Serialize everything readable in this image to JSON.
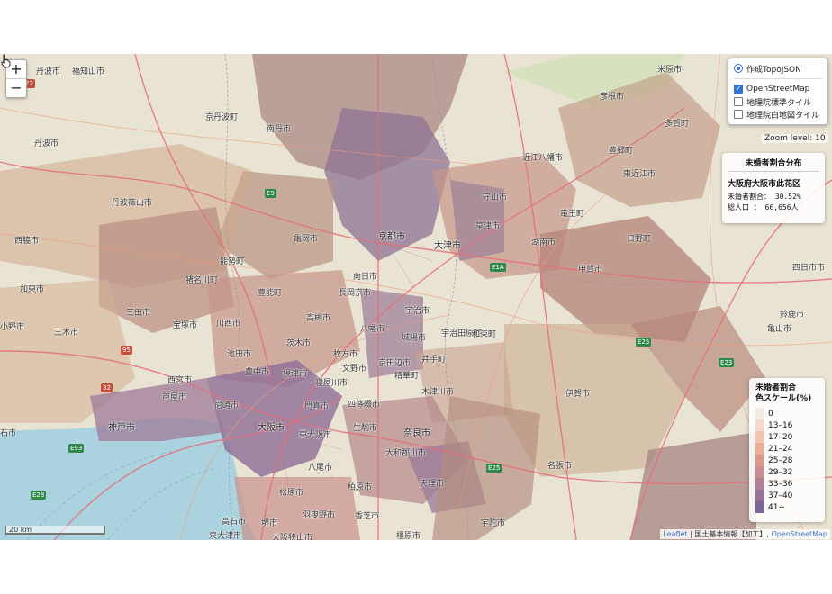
{
  "map": {
    "zoom_in": "+",
    "zoom_out": "−",
    "zoom_level_text": "Zoom level: 10",
    "scale_label": "20 km",
    "attribution": {
      "leaflet": "Leaflet",
      "sep1": " | 国土基本情報【加工】, ",
      "osm": "OpenStreetMap"
    }
  },
  "layers": {
    "overlay": {
      "label": "作成TopoJSON",
      "checked": true
    },
    "base": [
      {
        "label": "OpenStreetMap",
        "checked": true
      },
      {
        "label": "地理院標準タイル",
        "checked": false
      },
      {
        "label": "地理院白地図タイル",
        "checked": false
      }
    ]
  },
  "info": {
    "title": "未婚者割合分布",
    "area": "大阪府大阪市此花区",
    "rate_line": "未婚者割合：  30.52%",
    "pop_line": "総人口    ： 66,656人"
  },
  "legend": {
    "title": "未婚者割合\n色スケール(%)",
    "items": [
      {
        "label": "0",
        "color": "#f2ece3"
      },
      {
        "label": "13–16",
        "color": "#f6d9cc"
      },
      {
        "label": "17–20",
        "color": "#f2c3ad"
      },
      {
        "label": "21–24",
        "color": "#eaae96"
      },
      {
        "label": "25–28",
        "color": "#d99a8c"
      },
      {
        "label": "29–32",
        "color": "#c98c8f"
      },
      {
        "label": "33–36",
        "color": "#b27f97"
      },
      {
        "label": "37–40",
        "color": "#97729b"
      },
      {
        "label": "41+",
        "color": "#7c6596"
      }
    ]
  },
  "places": [
    {
      "name": "福知山市",
      "cls": ""
    },
    {
      "name": "米原市",
      "cls": ""
    },
    {
      "name": "南丹市",
      "cls": ""
    },
    {
      "name": "彦根市",
      "cls": ""
    },
    {
      "name": "京丹波町",
      "cls": ""
    },
    {
      "name": "丹波市",
      "cls": ""
    },
    {
      "name": "多賀町",
      "cls": ""
    },
    {
      "name": "近江八幡市",
      "cls": ""
    },
    {
      "name": "豊郷町",
      "cls": ""
    },
    {
      "name": "東近江市",
      "cls": ""
    },
    {
      "name": "丹波篠山市",
      "cls": ""
    },
    {
      "name": "守山市",
      "cls": ""
    },
    {
      "name": "竜王町",
      "cls": ""
    },
    {
      "name": "草津市",
      "cls": ""
    },
    {
      "name": "京都市",
      "cls": "major"
    },
    {
      "name": "亀岡市",
      "cls": ""
    },
    {
      "name": "西脇市",
      "cls": ""
    },
    {
      "name": "大津市",
      "cls": "major"
    },
    {
      "name": "湖南市",
      "cls": ""
    },
    {
      "name": "日野町",
      "cls": ""
    },
    {
      "name": "能勢町",
      "cls": ""
    },
    {
      "name": "甲賀市",
      "cls": ""
    },
    {
      "name": "四日市市",
      "cls": ""
    },
    {
      "name": "向日市",
      "cls": ""
    },
    {
      "name": "猪名川町",
      "cls": ""
    },
    {
      "name": "加東市",
      "cls": ""
    },
    {
      "name": "豊能町",
      "cls": ""
    },
    {
      "name": "長岡京市",
      "cls": ""
    },
    {
      "name": "三田市",
      "cls": ""
    },
    {
      "name": "宇治市",
      "cls": ""
    },
    {
      "name": "高槻市",
      "cls": ""
    },
    {
      "name": "鈴鹿市",
      "cls": ""
    },
    {
      "name": "宝塚市",
      "cls": ""
    },
    {
      "name": "川西市",
      "cls": ""
    },
    {
      "name": "八幡市",
      "cls": ""
    },
    {
      "name": "城陽市",
      "cls": ""
    },
    {
      "name": "宇治田原町",
      "cls": ""
    },
    {
      "name": "三木市",
      "cls": ""
    },
    {
      "name": "茨木市",
      "cls": ""
    },
    {
      "name": "亀山市",
      "cls": ""
    },
    {
      "name": "池田市",
      "cls": ""
    },
    {
      "name": "枚方市",
      "cls": ""
    },
    {
      "name": "和束町",
      "cls": ""
    },
    {
      "name": "京田辺市",
      "cls": ""
    },
    {
      "name": "井手町",
      "cls": ""
    },
    {
      "name": "豊中市",
      "cls": ""
    },
    {
      "name": "摂津市",
      "cls": ""
    },
    {
      "name": "文野市",
      "cls": ""
    },
    {
      "name": "西宮市",
      "cls": ""
    },
    {
      "name": "寝屋川市",
      "cls": ""
    },
    {
      "name": "精華町",
      "cls": ""
    },
    {
      "name": "木津川市",
      "cls": ""
    },
    {
      "name": "芦屋市",
      "cls": ""
    },
    {
      "name": "伊賀市",
      "cls": ""
    },
    {
      "name": "尼崎市",
      "cls": ""
    },
    {
      "name": "門真市",
      "cls": ""
    },
    {
      "name": "四條畷市",
      "cls": ""
    },
    {
      "name": "神戸市",
      "cls": "major"
    },
    {
      "name": "大阪市",
      "cls": "major"
    },
    {
      "name": "生駒市",
      "cls": ""
    },
    {
      "name": "奈良市",
      "cls": "major"
    },
    {
      "name": "東大阪市",
      "cls": ""
    },
    {
      "name": "大和郡山市",
      "cls": ""
    },
    {
      "name": "名張市",
      "cls": ""
    },
    {
      "name": "八尾市",
      "cls": ""
    },
    {
      "name": "柏原市",
      "cls": ""
    },
    {
      "name": "天理市",
      "cls": ""
    },
    {
      "name": "松原市",
      "cls": ""
    },
    {
      "name": "羽曳野市",
      "cls": ""
    },
    {
      "name": "香芝市",
      "cls": ""
    },
    {
      "name": "高石市",
      "cls": ""
    },
    {
      "name": "堺市",
      "cls": ""
    },
    {
      "name": "宇陀市",
      "cls": ""
    },
    {
      "name": "泉大津市",
      "cls": ""
    },
    {
      "name": "大阪狭山市",
      "cls": ""
    },
    {
      "name": "橿原市",
      "cls": ""
    },
    {
      "name": "石市",
      "cls": ""
    },
    {
      "name": "丹波市",
      "cls": ""
    },
    {
      "name": "小野市",
      "cls": ""
    }
  ],
  "routes": [
    {
      "name": "E9",
      "cls": "e"
    },
    {
      "name": "E1A",
      "cls": "e"
    },
    {
      "name": "E25",
      "cls": "e"
    },
    {
      "name": "E23",
      "cls": "e"
    },
    {
      "name": "E93",
      "cls": "e"
    },
    {
      "name": "E28",
      "cls": "e"
    },
    {
      "name": "E25",
      "cls": "e"
    },
    {
      "name": "95",
      "cls": "n"
    },
    {
      "name": "32",
      "cls": "n"
    },
    {
      "name": "72",
      "cls": "n"
    }
  ]
}
